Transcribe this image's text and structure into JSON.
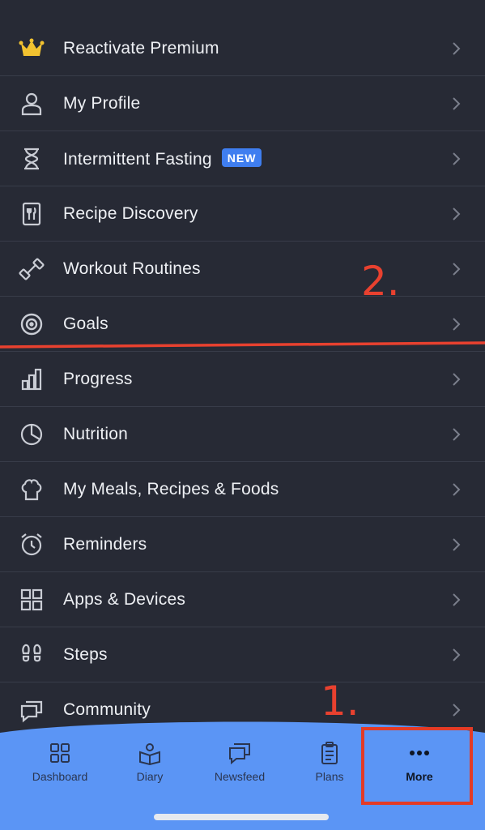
{
  "menu": [
    {
      "label": "Reactivate Premium",
      "icon": "crown-icon"
    },
    {
      "label": "My Profile",
      "icon": "profile-icon"
    },
    {
      "label": "Intermittent Fasting",
      "icon": "hourglass-icon",
      "badge": "NEW"
    },
    {
      "label": "Recipe Discovery",
      "icon": "recipe-book-icon"
    },
    {
      "label": "Workout Routines",
      "icon": "dumbbell-icon"
    },
    {
      "label": "Goals",
      "icon": "target-icon"
    },
    {
      "label": "Progress",
      "icon": "bar-chart-icon"
    },
    {
      "label": "Nutrition",
      "icon": "pie-chart-icon"
    },
    {
      "label": "My Meals, Recipes & Foods",
      "icon": "chef-hat-icon"
    },
    {
      "label": "Reminders",
      "icon": "alarm-clock-icon"
    },
    {
      "label": "Apps & Devices",
      "icon": "grid-icon"
    },
    {
      "label": "Steps",
      "icon": "footprints-icon"
    },
    {
      "label": "Community",
      "icon": "chat-bubbles-icon"
    }
  ],
  "annotations": {
    "step1": "1.",
    "step2": "2."
  },
  "tabs": [
    {
      "label": "Dashboard",
      "icon": "dashboard-icon"
    },
    {
      "label": "Diary",
      "icon": "diary-book-icon"
    },
    {
      "label": "Newsfeed",
      "icon": "newsfeed-icon"
    },
    {
      "label": "Plans",
      "icon": "clipboard-icon"
    },
    {
      "label": "More",
      "icon": "more-dots-icon",
      "active": true
    }
  ],
  "colors": {
    "background": "#272a35",
    "tabbar": "#5b95f5",
    "annotation": "#e8412f",
    "badge": "#3f7ef0",
    "crown": "#f2c230"
  }
}
